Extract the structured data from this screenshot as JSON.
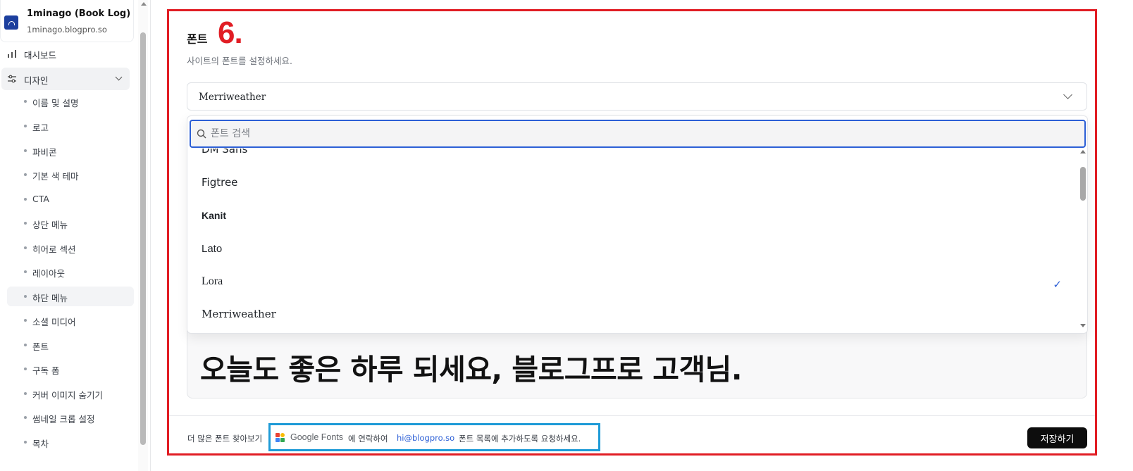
{
  "sidebar": {
    "site_name": "1minago (Book Log)",
    "site_domain": "1minago.blogpro.so",
    "dashboard_label": "대시보드",
    "design_label": "디자인",
    "design_items": [
      {
        "label": "이름 및 설명"
      },
      {
        "label": "로고"
      },
      {
        "label": "파비콘"
      },
      {
        "label": "기본 색 테마"
      },
      {
        "label": "CTA"
      },
      {
        "label": "상단 메뉴"
      },
      {
        "label": "히어로 섹션"
      },
      {
        "label": "레이아웃"
      },
      {
        "label": "하단 메뉴"
      },
      {
        "label": "소셜 미디어"
      },
      {
        "label": "폰트"
      },
      {
        "label": "구독 폼"
      },
      {
        "label": "커버 이미지 숨기기"
      },
      {
        "label": "썸네일 크롭 설정"
      },
      {
        "label": "목차"
      }
    ]
  },
  "font_section": {
    "title": "폰트",
    "step_number": "6.",
    "description": "사이트의 폰트를 설정하세요.",
    "selected_font": "Merriweather",
    "search_placeholder": "폰트 검색",
    "options": [
      {
        "label": "DM Sans"
      },
      {
        "label": "Figtree"
      },
      {
        "label": "Kanit"
      },
      {
        "label": "Lato"
      },
      {
        "label": "Lora"
      },
      {
        "label": "Merriweather",
        "selected": true
      }
    ],
    "preview_text": "오늘도 좋은 하루 되세요, 블로그프로 고객님."
  },
  "footer": {
    "more_fonts_text": "더 많은 폰트 찾아보기",
    "google_fonts_label": "Google Fonts",
    "contact_text": "에 연락하여",
    "email": "hi@blogpro.so",
    "request_text": "폰트 목록에 추가하도록 요청하세요.",
    "save_label": "저장하기"
  },
  "colors": {
    "annotation_red": "#e11d24",
    "annotation_blue": "#1e9bd7",
    "accent_blue": "#2c5fd6",
    "button_black": "#0d0d0d"
  },
  "icons": {
    "dashboard": "bar-chart-icon",
    "design": "sliders-icon",
    "search": "search-icon",
    "check": "check-icon",
    "google_fonts": "google-fonts-logo-icon"
  }
}
